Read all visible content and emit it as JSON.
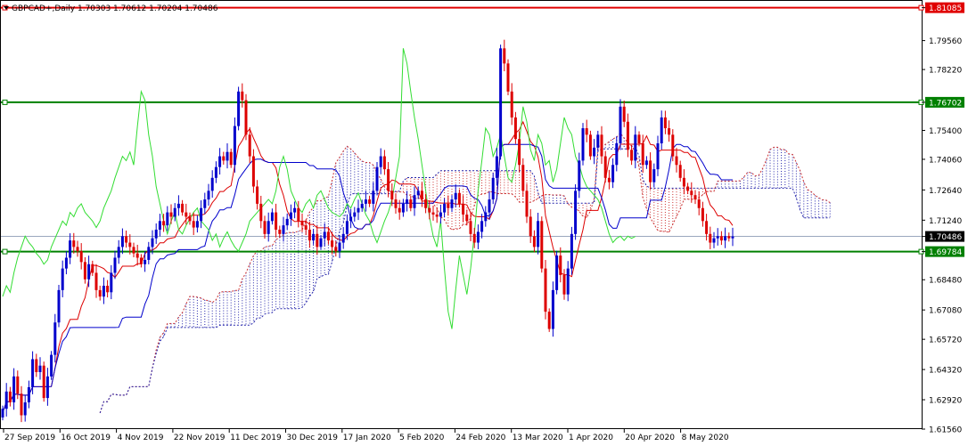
{
  "chart_data": {
    "type": "candlestick",
    "title": "GBPCAD+,Daily  1.70303 1.70612 1.70204 1.70486",
    "y_ticks": [
      "1.81085",
      "1.79560",
      "1.78220",
      "1.76702",
      "1.75400",
      "1.74060",
      "1.72640",
      "1.71240",
      "1.70486",
      "1.69784",
      "1.68480",
      "1.67080",
      "1.65720",
      "1.64320",
      "1.62920",
      "1.61560"
    ],
    "x_ticks": [
      "27 Sep 2019",
      "16 Oct 2019",
      "4 Nov 2019",
      "22 Nov 2019",
      "11 Dec 2019",
      "30 Dec 2019",
      "17 Jan 2020",
      "5 Feb 2020",
      "24 Feb 2020",
      "13 Mar 2020",
      "1 Apr 2020",
      "20 Apr 2020",
      "8 May 2020"
    ],
    "ylim": [
      1.6156,
      1.814
    ],
    "horizontal_lines": [
      {
        "label": "1.81085",
        "value": 1.81085,
        "color": "#e00000"
      },
      {
        "label": "1.76702",
        "value": 1.76702,
        "color": "#008000"
      },
      {
        "label": "1.70486",
        "value": 1.70486,
        "color": "#000000"
      },
      {
        "label": "1.69784",
        "value": 1.69784,
        "color": "#008000"
      }
    ],
    "colors": {
      "bull": "#0000cc",
      "bear": "#dd0000",
      "tenkan": "#dd0000",
      "kijun": "#0000cc",
      "chikou": "#33dd33",
      "grid": "#c0c0c0"
    },
    "closes": [
      1.625,
      1.633,
      1.628,
      1.64,
      1.632,
      1.622,
      1.628,
      1.635,
      1.648,
      1.642,
      1.645,
      1.63,
      1.64,
      1.65,
      1.665,
      1.68,
      1.69,
      1.695,
      1.703,
      1.7,
      1.698,
      1.693,
      1.685,
      1.692,
      1.688,
      1.68,
      1.677,
      1.682,
      1.679,
      1.688,
      1.695,
      1.7,
      1.705,
      1.702,
      1.7,
      1.697,
      1.695,
      1.692,
      1.694,
      1.7,
      1.704,
      1.708,
      1.712,
      1.71,
      1.716,
      1.714,
      1.718,
      1.72,
      1.716,
      1.714,
      1.712,
      1.709,
      1.712,
      1.718,
      1.722,
      1.726,
      1.732,
      1.737,
      1.742,
      1.74,
      1.744,
      1.738,
      1.756,
      1.772,
      1.768,
      1.752,
      1.742,
      1.728,
      1.72,
      1.712,
      1.706,
      1.712,
      1.716,
      1.708,
      1.706,
      1.71,
      1.713,
      1.716,
      1.718,
      1.712,
      1.71,
      1.708,
      1.703,
      1.706,
      1.7,
      1.704,
      1.707,
      1.703,
      1.7,
      1.698,
      1.702,
      1.706,
      1.712,
      1.714,
      1.716,
      1.718,
      1.72,
      1.722,
      1.72,
      1.726,
      1.737,
      1.742,
      1.736,
      1.726,
      1.722,
      1.718,
      1.716,
      1.72,
      1.722,
      1.718,
      1.724,
      1.726,
      1.722,
      1.718,
      1.716,
      1.715,
      1.714,
      1.716,
      1.72,
      1.718,
      1.722,
      1.725,
      1.72,
      1.715,
      1.712,
      1.706,
      1.702,
      1.707,
      1.712,
      1.716,
      1.722,
      1.732,
      1.742,
      1.792,
      1.785,
      1.772,
      1.76,
      1.75,
      1.738,
      1.726,
      1.714,
      1.705,
      1.7,
      1.712,
      1.69,
      1.67,
      1.662,
      1.68,
      1.696,
      1.687,
      1.678,
      1.69,
      1.706,
      1.726,
      1.74,
      1.755,
      1.752,
      1.742,
      1.746,
      1.752,
      1.742,
      1.732,
      1.73,
      1.738,
      1.748,
      1.765,
      1.758,
      1.745,
      1.74,
      1.752,
      1.748,
      1.738,
      1.74,
      1.73,
      1.736,
      1.748,
      1.76,
      1.755,
      1.752,
      1.742,
      1.738,
      1.732,
      1.728,
      1.726,
      1.724,
      1.722,
      1.718,
      1.712,
      1.706,
      1.702,
      1.704,
      1.705,
      1.703,
      1.705,
      1.704,
      1.70486
    ]
  }
}
